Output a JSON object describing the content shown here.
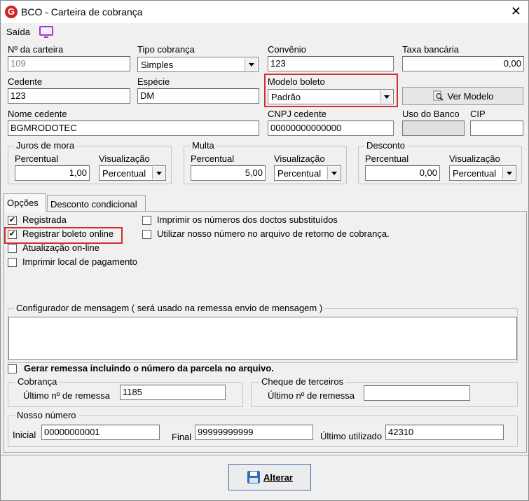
{
  "window": {
    "title": "BCO - Carteira de cobrança",
    "icon": "app-logo-icon",
    "close": "✕"
  },
  "saida": {
    "label": "Saída",
    "icon": "monitor-icon"
  },
  "fields": {
    "num_carteira": {
      "label": "Nº da carteira",
      "value": "109"
    },
    "tipo_cobranca": {
      "label": "Tipo cobrança",
      "value": "Simples"
    },
    "convenio": {
      "label": "Convênio",
      "value": "123"
    },
    "taxa_bancaria": {
      "label": "Taxa bancária",
      "value": "0,00"
    },
    "cedente": {
      "label": "Cedente",
      "value": "123"
    },
    "especie": {
      "label": "Espécie",
      "value": "DM"
    },
    "modelo_boleto": {
      "label": "Modelo boleto",
      "value": "Padrão"
    },
    "ver_modelo": {
      "label": "Ver Modelo",
      "icon": "magnifier-icon"
    },
    "nome_cedente": {
      "label": "Nome cedente",
      "value": "BGMRODOTEC"
    },
    "cnpj_cedente": {
      "label": "CNPJ cedente",
      "value": "00000000000000"
    },
    "uso_banco": {
      "label": "Uso do Banco",
      "value": ""
    },
    "cip": {
      "label": "CIP",
      "value": ""
    }
  },
  "juros": {
    "title": "Juros de mora",
    "percentual_label": "Percentual",
    "percentual": "1,00",
    "visualizacao_label": "Visualização",
    "visualizacao": "Percentual"
  },
  "multa": {
    "title": "Multa",
    "percentual_label": "Percentual",
    "percentual": "5,00",
    "visualizacao_label": "Visualização",
    "visualizacao": "Percentual"
  },
  "desconto": {
    "title": "Desconto",
    "percentual_label": "Percentual",
    "percentual": "0,00",
    "visualizacao_label": "Visualização",
    "visualizacao": "Percentual"
  },
  "tabs": [
    {
      "label": "Opções"
    },
    {
      "label": "Desconto condicional"
    }
  ],
  "options": {
    "registrada": {
      "label": "Registrada",
      "checked": true
    },
    "registrar_online": {
      "label": "Registrar boleto online",
      "checked": true
    },
    "atualizacao_online": {
      "label": "Atualização on-line",
      "checked": false
    },
    "imprimir_local": {
      "label": "Imprimir local de pagamento",
      "checked": false
    },
    "imprimir_numeros": {
      "label": "Imprimir os números dos doctos substituídos",
      "checked": false
    },
    "utilizar_nosso_numero": {
      "label": "Utilizar nosso número no arquivo de retorno de cobrança.",
      "checked": false
    }
  },
  "configurador": {
    "title": "Configurador de mensagem ( será usado na remessa envio de mensagem )",
    "value": ""
  },
  "gerar_remessa": {
    "label": "Gerar remessa incluindo o número da parcela no arquivo.",
    "checked": false
  },
  "cobranca": {
    "title": "Cobrança",
    "label": "Último nº  de remessa",
    "value": "1185"
  },
  "cheque": {
    "title": "Cheque de terceiros",
    "label": "Último nº  de remessa",
    "value": ""
  },
  "nosso_numero": {
    "title": "Nosso número",
    "inicial_label": "Inicial",
    "inicial": "00000000001",
    "final_label": "Final",
    "final": "99999999999",
    "ultimo_label": "Último utilizado",
    "ultimo": "42310"
  },
  "alterar_button": {
    "label": "Alterar",
    "icon": "floppy-disk-icon"
  },
  "colors": {
    "highlight": "#d23030",
    "accent": "#a03ad0",
    "button_border": "#3c6eb4"
  }
}
